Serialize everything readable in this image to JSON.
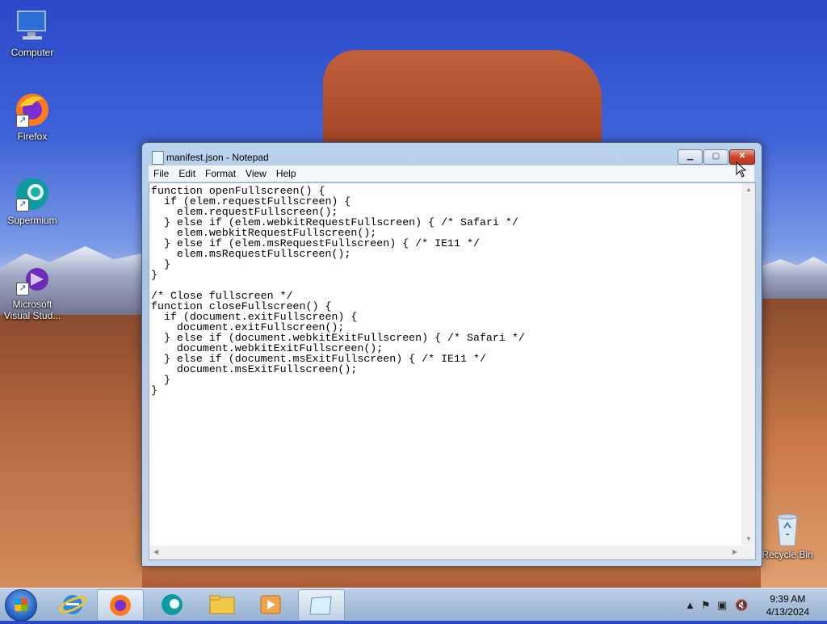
{
  "desktop": {
    "icons": [
      {
        "label": "Computer"
      },
      {
        "label": "Firefox"
      },
      {
        "label": "Supermium"
      },
      {
        "label": "Microsoft Visual Stud..."
      },
      {
        "label": "Recycle Bin"
      }
    ]
  },
  "window": {
    "title": "manifest.json - Notepad",
    "controls": {
      "minimize": "▁",
      "maximize": "▢",
      "close": "✕"
    },
    "menu": [
      "File",
      "Edit",
      "Format",
      "View",
      "Help"
    ],
    "content": "function openFullscreen() {\n  if (elem.requestFullscreen) {\n    elem.requestFullscreen();\n  } else if (elem.webkitRequestFullscreen) { /* Safari */\n    elem.webkitRequestFullscreen();\n  } else if (elem.msRequestFullscreen) { /* IE11 */\n    elem.msRequestFullscreen();\n  }\n}\n\n/* Close fullscreen */\nfunction closeFullscreen() {\n  if (document.exitFullscreen) {\n    document.exitFullscreen();\n  } else if (document.webkitExitFullscreen) { /* Safari */\n    document.webkitExitFullscreen();\n  } else if (document.msExitFullscreen) { /* IE11 */\n    document.msExitFullscreen();\n  }\n}"
  },
  "taskbar": {
    "apps": [
      {
        "name": "internet-explorer-icon"
      },
      {
        "name": "firefox-icon"
      },
      {
        "name": "supermium-icon"
      },
      {
        "name": "file-explorer-icon"
      },
      {
        "name": "media-player-icon"
      },
      {
        "name": "notepad-icon"
      }
    ],
    "time": "9:39 AM",
    "date": "4/13/2024"
  },
  "colors": {
    "accent": "#1d58b8",
    "close": "#c8432a"
  }
}
